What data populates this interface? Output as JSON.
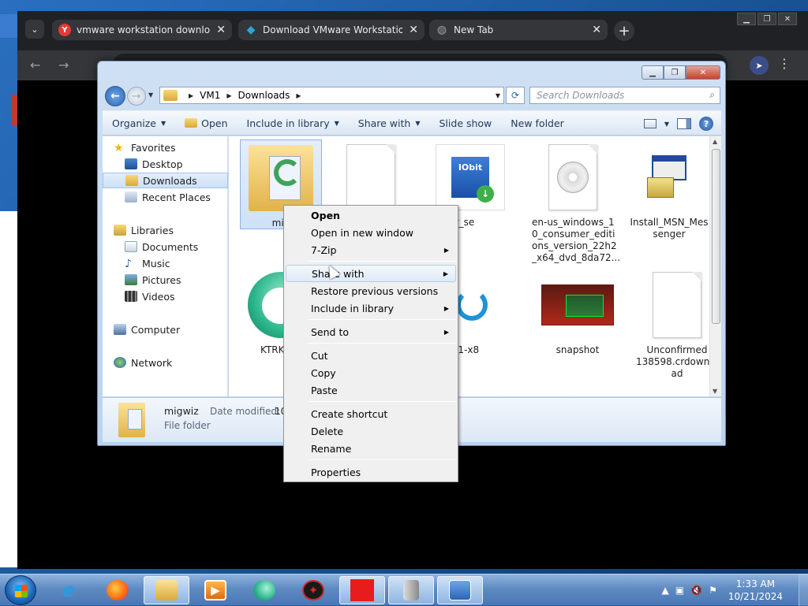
{
  "browser": {
    "tabs": [
      {
        "label": "vmware workstation download —",
        "icon": "yandex-icon",
        "icon_glyph": "Y",
        "icon_color": "#e53935"
      },
      {
        "label": "Download VMware Workstation Pr",
        "icon": "vmware-download-icon",
        "icon_glyph": "◆",
        "icon_color": "#2aa6d6"
      },
      {
        "label": "New Tab",
        "icon": "globe-icon",
        "icon_glyph": "◍",
        "icon_color": "#9aa0a6"
      }
    ],
    "new_tab_glyph": "+",
    "back_glyph": "←",
    "forward_glyph": "→"
  },
  "explorer": {
    "breadcrumb": [
      "VM1",
      "Downloads"
    ],
    "search_placeholder": "Search Downloads",
    "commands": {
      "organize": "Organize",
      "open": "Open",
      "include_in_library": "Include in library",
      "share_with": "Share with",
      "slide_show": "Slide show",
      "new_folder": "New folder"
    },
    "nav": {
      "favorites": "Favorites",
      "desktop": "Desktop",
      "downloads": "Downloads",
      "recent_places": "Recent Places",
      "libraries": "Libraries",
      "documents": "Documents",
      "music": "Music",
      "pictures": "Pictures",
      "videos": "Videos",
      "computer": "Computer",
      "network": "Network"
    },
    "files": {
      "migwiz": "mig",
      "driverbooster": "booster_se\ntup",
      "en_us_windows": "en-us_windows_1\n0_consumer_editi\nons_version_22h2\n_x64_dvd_8da72...",
      "install_msn": "Install_MSN_Mes\nsenger",
      "ktrk": "KTRK",
      "sk": "sk-1.3.1-x8\n64 (2)",
      "snapshot": "snapshot",
      "unconfirmed": "Unconfirmed\n138598.crdownlo\nad"
    },
    "details": {
      "name": "migwiz",
      "type": "File folder",
      "date_label": "Date modified:",
      "date_value": "10"
    }
  },
  "context_menu": {
    "open": "Open",
    "open_new_window": "Open in new window",
    "zip": "7-Zip",
    "share_with": "Share with",
    "restore_previous": "Restore previous versions",
    "include_in_library": "Include in library",
    "send_to": "Send to",
    "cut": "Cut",
    "copy": "Copy",
    "paste": "Paste",
    "create_shortcut": "Create shortcut",
    "delete": "Delete",
    "rename": "Rename",
    "properties": "Properties"
  },
  "taskbar": {
    "time": "1:33 AM",
    "date": "10/21/2024"
  },
  "colors": {
    "selection": "#cfe1f8",
    "taskbar": "#5f8bc3",
    "chrome_dark": "#202124"
  }
}
